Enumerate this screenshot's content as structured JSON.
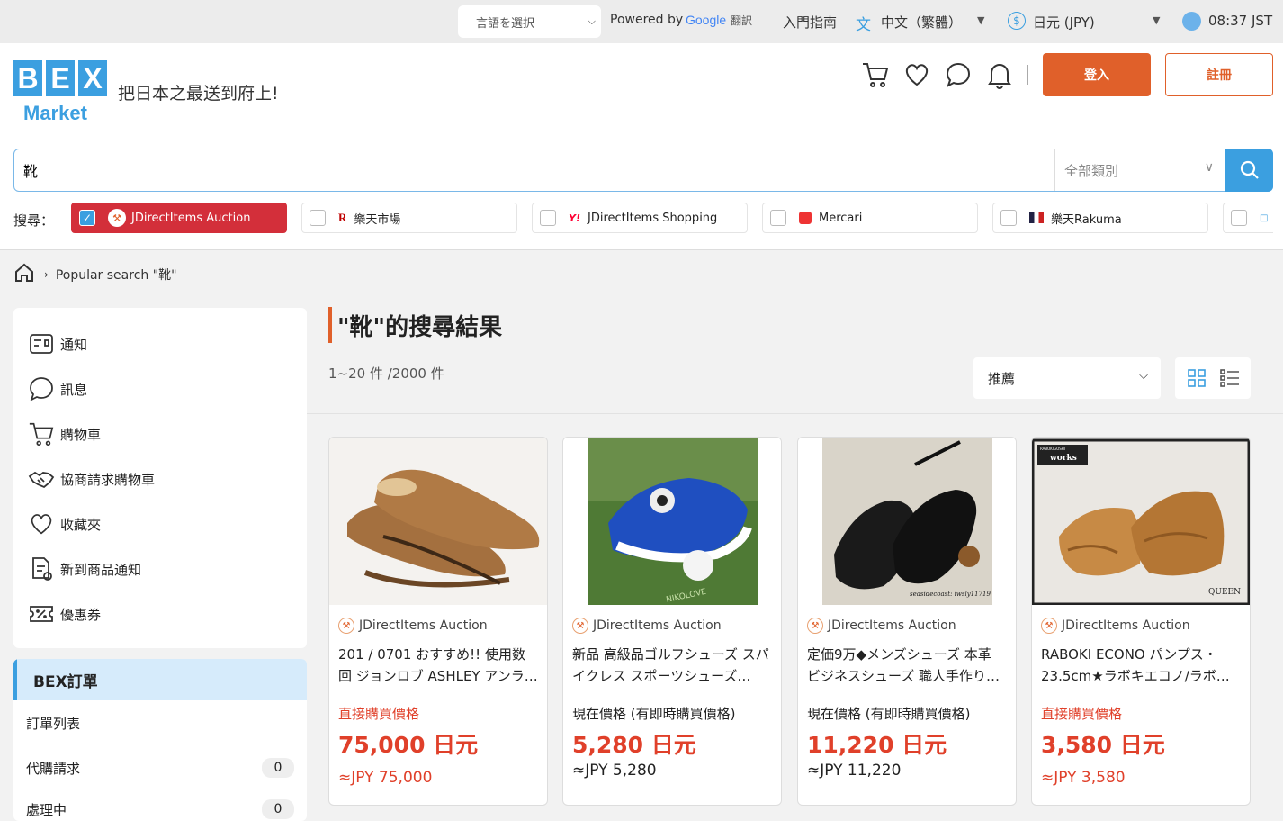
{
  "topbar": {
    "lang_select": "言語を選択",
    "powered_by": "Powered by",
    "google": "Google",
    "translate": "翻訳",
    "guide": "入門指南",
    "language": "中文（繁體）",
    "currency": "日元 (JPY)",
    "time": "08:37 JST"
  },
  "header": {
    "logo_letters": [
      "B",
      "E",
      "X"
    ],
    "logo_market": "Market",
    "tagline": "把日本之最送到府上!",
    "login": "登入",
    "register": "註冊"
  },
  "search": {
    "query": "靴",
    "category": "全部類別",
    "sources_label": "搜尋：",
    "sources": [
      {
        "name": "JDirectItems Auction",
        "active": true
      },
      {
        "name": "樂天市場",
        "active": false
      },
      {
        "name": "JDirectItems Shopping",
        "active": false
      },
      {
        "name": "Mercari",
        "active": false
      },
      {
        "name": "樂天Rakuma",
        "active": false
      }
    ]
  },
  "breadcrumb": {
    "current": "Popular search \"靴\""
  },
  "sidebar": {
    "menu": [
      "通知",
      "訊息",
      "購物車",
      "協商請求購物車",
      "收藏夾",
      "新到商品通知",
      "優惠券"
    ],
    "orders_title": "BEX訂單",
    "orders": [
      {
        "label": "訂單列表",
        "count": null
      },
      {
        "label": "代購請求",
        "count": "0"
      },
      {
        "label": "處理中",
        "count": "0"
      }
    ]
  },
  "results": {
    "title": "\"靴\"的搜尋結果",
    "count": "1~20 件 /2000 件",
    "sort": "推薦"
  },
  "products": [
    {
      "source": "JDirectItems Auction",
      "title": "201 / 0701 おすすめ!! 使用数回 ジョンロブ ASHLEY アンライ…",
      "price_label": "直接購買價格",
      "price": "75,000 日元",
      "jpy": "≈JPY 75,000",
      "label_color": "#e0402a"
    },
    {
      "source": "JDirectItems Auction",
      "title": "新品 高級品ゴルフシューズ スパイクレス スポーツシューズ…",
      "price_label": "現在價格 (有即時購買價格)",
      "price": "5,280 日元",
      "jpy": "≈JPY 5,280",
      "label_color": "#222222"
    },
    {
      "source": "JDirectItems Auction",
      "title": "定価9万◆メンズシューズ 本革 ビジネスシューズ 職人手作り…",
      "price_label": "現在價格 (有即時購買價格)",
      "price": "11,220 日元",
      "jpy": "≈JPY 11,220",
      "label_color": "#222222"
    },
    {
      "source": "JDirectItems Auction",
      "title": "RABOKI ECONO パンプス・23.5cm★ラボキエコノ/ラボ…",
      "price_label": "直接購買價格",
      "price": "3,580 日元",
      "jpy": "≈JPY 3,580",
      "label_color": "#e0402a"
    }
  ],
  "image_text": {
    "golf_watermark": "NIKOLOVE",
    "oxford_watermark": "seasidecoast: iwsly11719",
    "pump_brand": "works",
    "pump_small": "RABOKIGOSHI",
    "pump_watermark": "QUEEN"
  }
}
